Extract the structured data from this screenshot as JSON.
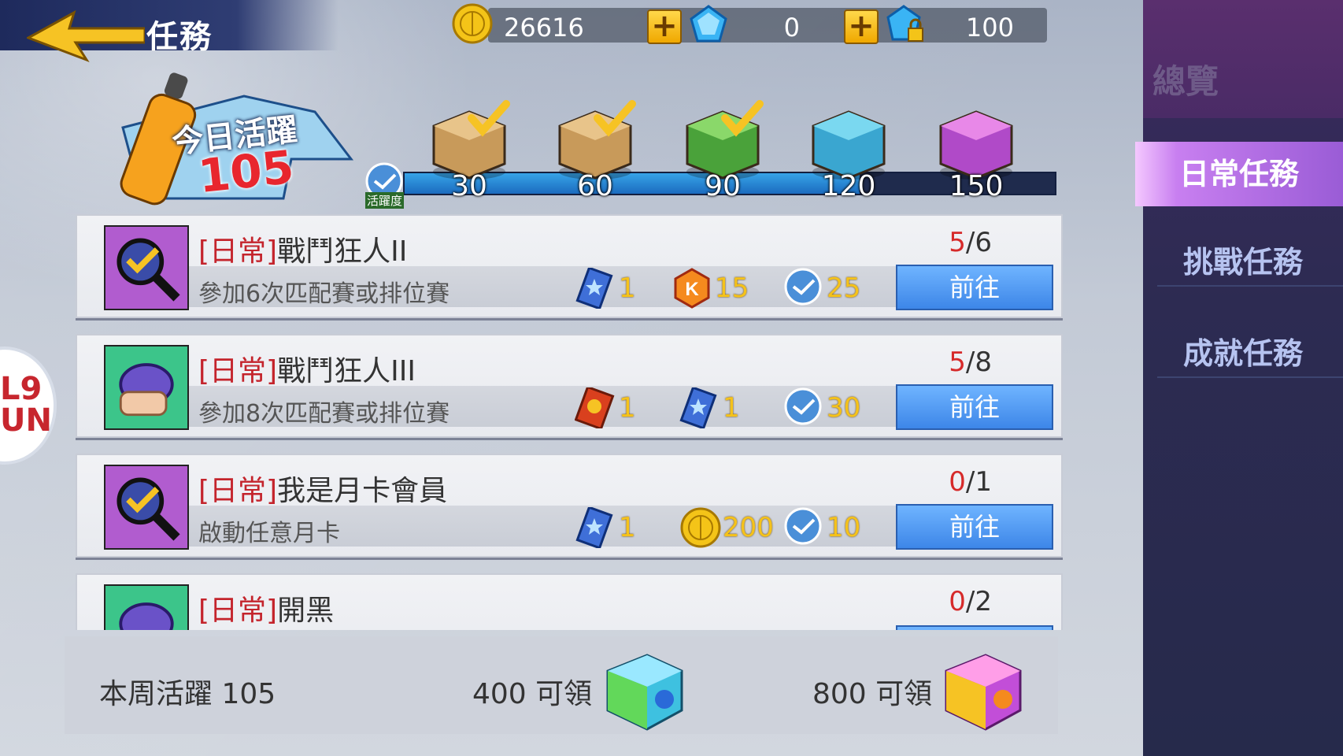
{
  "header": {
    "title": "任務",
    "coins": "26616",
    "diamonds": "0",
    "locked_diamonds": "100"
  },
  "daily": {
    "badge_title": "今日活躍",
    "badge_value": "105",
    "icon_label": "活躍度",
    "progress_fraction": 0.7,
    "milestones": [
      "30",
      "60",
      "90",
      "120",
      "150"
    ],
    "milestone_claimed": [
      true,
      true,
      true,
      false,
      false
    ]
  },
  "sidebar": {
    "overview": "總覽",
    "items": [
      {
        "label": "日常任務",
        "active": true
      },
      {
        "label": "挑戰任務",
        "active": false
      },
      {
        "label": "成就任務",
        "active": false
      }
    ]
  },
  "tasks": [
    {
      "tag": "[日常]",
      "name": "戰鬥狂人II",
      "desc": "參加6次匹配賽或排位賽",
      "progress_current": "5",
      "progress_total": "/6",
      "rewards": [
        "1",
        "15",
        "25"
      ],
      "button": "前往"
    },
    {
      "tag": "[日常]",
      "name": "戰鬥狂人III",
      "desc": "參加8次匹配賽或排位賽",
      "progress_current": "5",
      "progress_total": "/8",
      "rewards": [
        "1",
        "1",
        "30"
      ],
      "button": "前往"
    },
    {
      "tag": "[日常]",
      "name": "我是月卡會員",
      "desc": "啟動任意月卡",
      "progress_current": "0",
      "progress_total": "/1",
      "rewards": [
        "1",
        "200",
        "10"
      ],
      "button": "前往"
    },
    {
      "tag": "[日常]",
      "name": "開黑",
      "desc": "",
      "progress_current": "0",
      "progress_total": "/2",
      "rewards": [],
      "button": ""
    }
  ],
  "weekly": {
    "label": "本周活躍 105",
    "reward1": "400 可領",
    "reward2": "800 可領"
  },
  "side_bubble": "L9\nUN"
}
